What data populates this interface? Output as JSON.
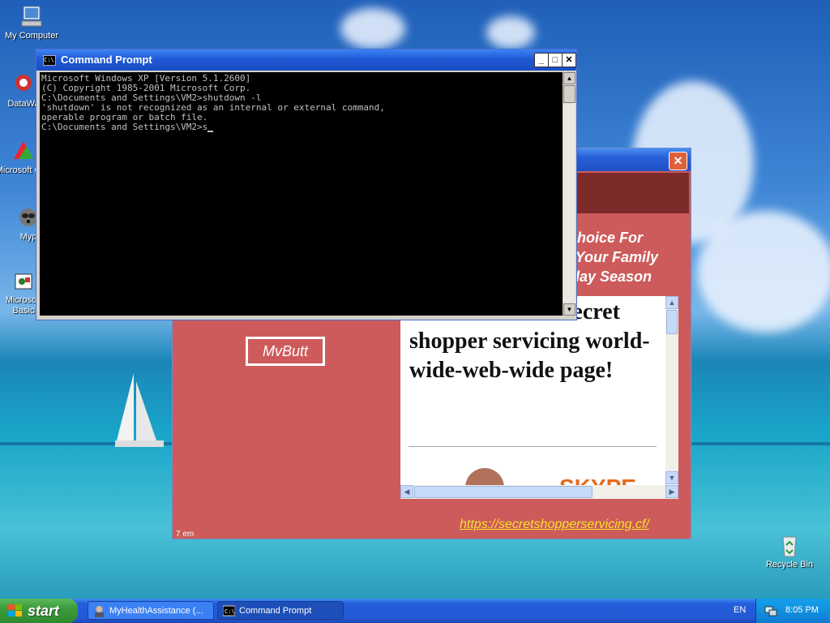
{
  "desktop": {
    "icons": [
      {
        "label": "My Computer"
      },
      {
        "label": "DataWa"
      },
      {
        "label": "Microsoft C++"
      },
      {
        "label": "Myp"
      },
      {
        "label": "Microsoft Basic"
      },
      {
        "label": "Recycle Bin"
      }
    ]
  },
  "app_window": {
    "close_glyph": "✕",
    "slogan": "d Choice For\nnd Your Family\noliday Season",
    "button_label": "MvButt",
    "web_heading": "Welcome to the secret shopper servicing world-wide-web-wide page!",
    "web_partial_text": "SKYPE",
    "link": "https://secretshopperservicing.cf/",
    "cut_label": "7 em"
  },
  "cmd_window": {
    "title": "Command Prompt",
    "icon_text": "C:\\",
    "minimize": "_",
    "maximize": "□",
    "close": "✕",
    "lines": [
      "Microsoft Windows XP [Version 5.1.2600]",
      "(C) Copyright 1985-2001 Microsoft Corp.",
      "",
      "C:\\Documents and Settings\\VM2>shutdown -l",
      "'shutdown' is not recognized as an internal or external command,",
      "operable program or batch file.",
      "",
      "C:\\Documents and Settings\\VM2>s"
    ]
  },
  "taskbar": {
    "start_label": "start",
    "buttons": [
      {
        "label": "MyHealthAssistance (...",
        "icon": "person-icon"
      },
      {
        "label": "Command Prompt",
        "icon": "cmd-icon"
      }
    ],
    "language": "EN",
    "clock": "8:05 PM"
  },
  "colors": {
    "app_background": "#cd5b5b",
    "app_band": "#7d2a2a",
    "link": "#f3e12a",
    "xp_blue": "#245edb",
    "start_green": "#3c9b3c"
  }
}
